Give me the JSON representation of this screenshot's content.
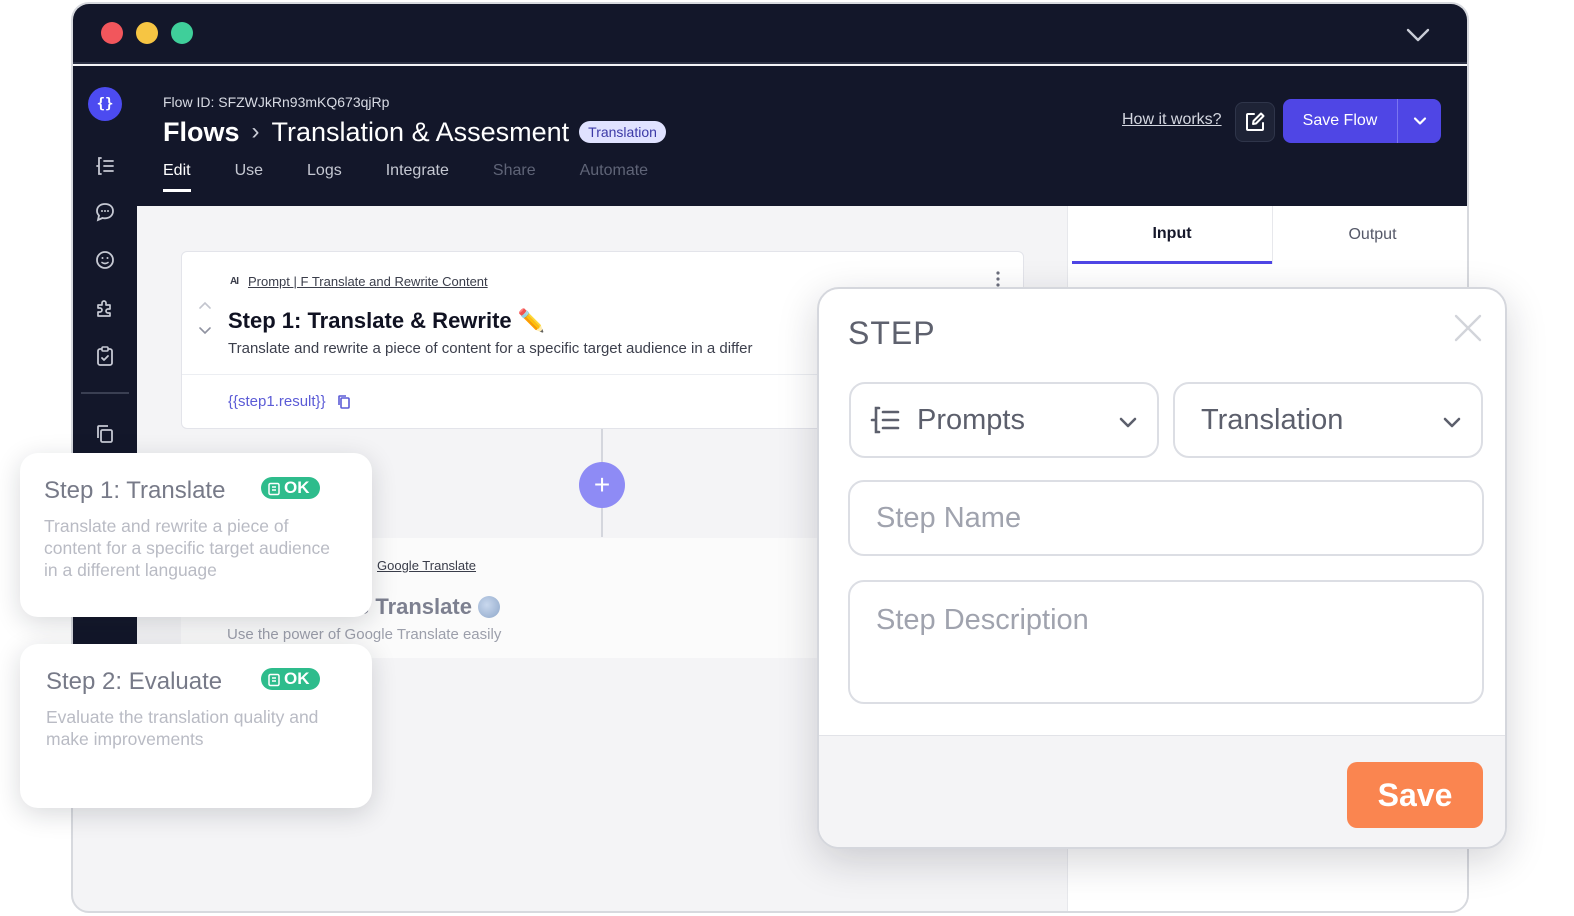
{
  "header": {
    "flow_id": "Flow ID: SFZWJkRn93mKQ673qjRp",
    "crumb_root": "Flows",
    "crumb_separator": "›",
    "title": "Translation & Assesment",
    "badge": "Translation",
    "how_it_works": "How it works?",
    "save_flow": "Save Flow",
    "tabs": [
      {
        "label": "Edit"
      },
      {
        "label": "Use"
      },
      {
        "label": "Logs"
      },
      {
        "label": "Integrate"
      },
      {
        "label": "Share"
      },
      {
        "label": "Automate"
      }
    ]
  },
  "sidebar": {
    "logo": "{}",
    "icons": [
      "prompts-icon",
      "chat-icon",
      "face-icon",
      "puzzle-icon",
      "clipboard-icon",
      "copy-doc-icon"
    ]
  },
  "canvas": {
    "step1": {
      "source_prefix": "AI",
      "source": "Prompt | F Translate and Rewrite Content",
      "title": "Step 1: Translate & Rewrite ✏️",
      "description": "Translate and rewrite a piece of content for a specific target audience in a differ",
      "result": "{{step1.result}}"
    },
    "add_label": "+",
    "step2": {
      "source": "Google Translate",
      "title": "e Translate",
      "description": "Use the power of Google Translate easily"
    }
  },
  "right_panel": {
    "tabs": [
      {
        "label": "Input"
      },
      {
        "label": "Output"
      }
    ]
  },
  "floating_cards": [
    {
      "title": "Step 1: Translate",
      "status": "OK",
      "description": "Translate and rewrite a piece of content for a specific target audience in a different language"
    },
    {
      "title": "Step 2: Evaluate",
      "status": "OK",
      "description": "Evaluate the translation quality and make improvements"
    }
  ],
  "modal": {
    "title": "STEP",
    "type_select": "Prompts",
    "category_select": "Translation",
    "name_placeholder": "Step Name",
    "description_placeholder": "Step Description",
    "save_label": "Save"
  },
  "colors": {
    "dark_bg": "#13172a",
    "accent": "#4f46e5",
    "ok_green": "#2ebc8c",
    "save_orange": "#fa8550"
  }
}
